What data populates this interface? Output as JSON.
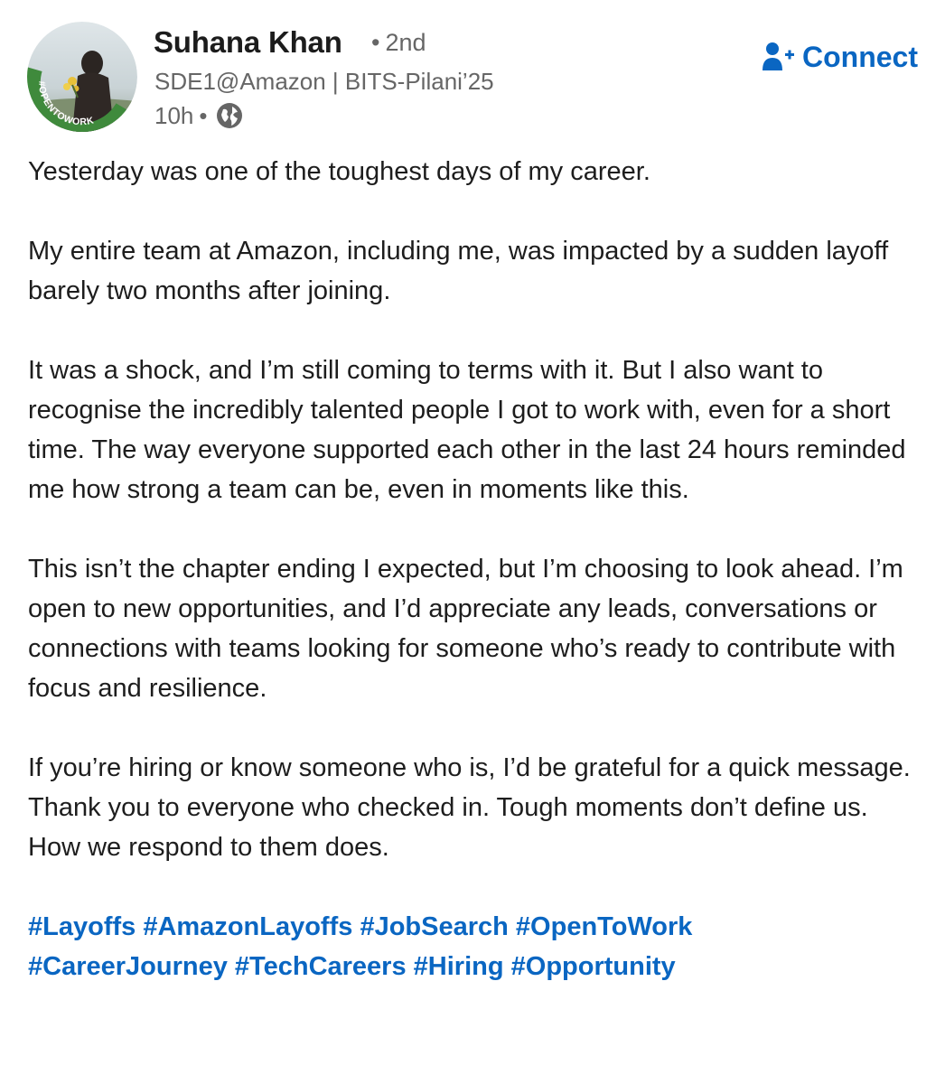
{
  "author": {
    "name": "Suhana Khan",
    "degree_dot": "•",
    "degree": "2nd",
    "headline": "SDE1@Amazon | BITS-Pilani’25",
    "time": "10h",
    "time_sep": "•",
    "visibility_icon": "globe-icon",
    "avatar_badge": "#OPENTOWORK",
    "avatar_ring_color": "#3f8a3c"
  },
  "connect_button": {
    "label": "Connect",
    "icon": "add-person-icon",
    "color": "#0a66c2"
  },
  "post": {
    "paragraphs": [
      "Yesterday was one of the toughest days of my career.",
      "My entire team at Amazon, including me, was impacted by a sudden layoff barely two months after joining.",
      "It was a shock, and I’m still coming to terms with it. But I also want to recognise the incredibly talented people I got to work with, even for a short time. The way everyone supported each other in the last 24 hours reminded me how strong a team can be, even in moments like this.",
      "This isn’t the chapter ending I expected, but I’m choosing to look ahead. I’m open to new opportunities, and I’d appreciate any leads, conversations or connections with teams looking for someone who’s ready to contribute with focus and resilience.",
      "If you’re hiring or know someone who is, I’d be grateful for a quick message.",
      "Thank you to everyone who checked in. Tough moments don’t define us. How we respond to them does."
    ],
    "hashtags": [
      "#Layoffs",
      "#AmazonLayoffs",
      "#JobSearch",
      "#OpenToWork",
      "#CareerJourney",
      "#TechCareers",
      "#Hiring",
      "#Opportunity"
    ]
  }
}
